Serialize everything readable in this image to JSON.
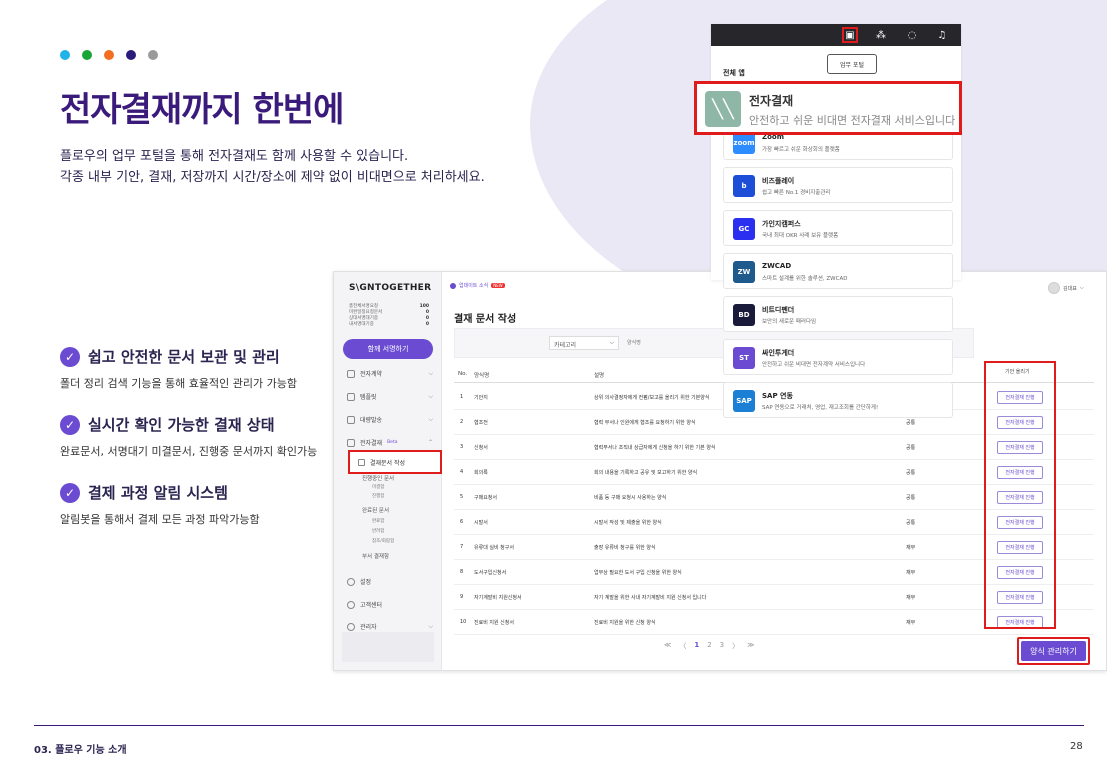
{
  "slide": {
    "title": "전자결재까지 한번에",
    "desc_1": "플로우의 업무 포털을 통해 전자결재도 함께 사용할 수 있습니다.",
    "desc_2": "각종 내부 기안, 결재, 저장까지 시간/장소에 제약 없이 비대면으로 처리하세요.",
    "dot_colors": [
      "#1fb3e8",
      "#1aa637",
      "#f26f21",
      "#2a1d7a",
      "#9a9a9a"
    ],
    "features": [
      {
        "title": "쉽고 안전한 문서 보관 및 관리",
        "desc": "폴더 정리 검색 기능을 통해 효율적인 관리가 가능함"
      },
      {
        "title": "실시간 확인 가능한 결재 상태",
        "desc": "완료문서, 서명대기 미결문서, 진행중 문서까지 확인가능"
      },
      {
        "title": "결제 과정 알림 시스템",
        "desc": "알림봇을 통해서 결제 모든 과정 파악가능함"
      }
    ],
    "footer_left": "03. 플로우 기능 소개",
    "footer_right": "28",
    "accent": "#6a4bd1",
    "highlight": "#e01b1b"
  },
  "app": {
    "logo": "S\\GNTOGETHER",
    "stats": [
      {
        "label": "총전체서명요청",
        "value": "100"
      },
      {
        "label": "미완일정요청문서",
        "value": "0"
      },
      {
        "label": "상대서명대기중",
        "value": "0"
      },
      {
        "label": "내서명대기중",
        "value": "0"
      }
    ],
    "sign_button": "함께 서명하기",
    "menu": {
      "m1": "전자계약",
      "m2": "템플릿",
      "m3": "대량발송",
      "m4": "전자결재",
      "m4_badge": "Beta",
      "highlighted": "결재문서 작성",
      "sub1": "진행중인 문서",
      "sub1a": "미결함",
      "sub1b": "진행함",
      "sub2": "완료된 문서",
      "sub2a": "완료함",
      "sub2b": "반려함",
      "sub2c": "참조/회람함",
      "sub3": "부서 결재함",
      "m5": "설정",
      "m6": "고객센터",
      "m7": "관리자"
    },
    "topbar_notice": "업데이트 소식",
    "topbar_new": "NEW",
    "user_name": "김대표",
    "page_title": "결재 문서 작성",
    "filter_category": "카테고리",
    "filter_placeholder": "양식명",
    "table_headers": {
      "no": "No.",
      "name": "양식명",
      "desc": "설명",
      "group": "",
      "action": "기안 올리기"
    },
    "rows": [
      {
        "no": "1",
        "name": "기안지",
        "desc": "상위 의사결정자에게 컨펌/보고를 올리기 위한 기본양식",
        "group": "공통",
        "action": "전자결재 진행"
      },
      {
        "no": "2",
        "name": "협조전",
        "desc": "협력 부서나 인원에게 협조를 요청하기 위한 양식",
        "group": "공통",
        "action": "전자결재 진행"
      },
      {
        "no": "3",
        "name": "신청서",
        "desc": "협력부서나 조직내 상급자에게 신청을 하기 위한 기본 양식",
        "group": "공통",
        "action": "전자결재 진행"
      },
      {
        "no": "4",
        "name": "회의록",
        "desc": "회의 내용을 기록하고 공유 및 보고하기 위한 양식",
        "group": "공통",
        "action": "전자결재 진행"
      },
      {
        "no": "5",
        "name": "구매요청서",
        "desc": "비품 등 구매 요청시 사용하는 양식",
        "group": "공통",
        "action": "전자결재 진행"
      },
      {
        "no": "6",
        "name": "시말서",
        "desc": "시말서 작성 및 제출을 위한 양식",
        "group": "공통",
        "action": "전자결재 진행"
      },
      {
        "no": "7",
        "name": "유류대 실비 청구서",
        "desc": "출장 유류비 청구를 위한 양식",
        "group": "재무",
        "action": "전자결재 진행"
      },
      {
        "no": "8",
        "name": "도서구입신청서",
        "desc": "업무상 필요한 도서 구입 신청을 위한 양식",
        "group": "재무",
        "action": "전자결재 진행"
      },
      {
        "no": "9",
        "name": "자기계발비 지원신청서",
        "desc": "자기 계발을 위한 사내 자기계발비 지원 신청서 입니다",
        "group": "재무",
        "action": "전자결재 진행"
      },
      {
        "no": "10",
        "name": "진료비 지원 신청서",
        "desc": "진료비 지원을 위한 신청 양식",
        "group": "재무",
        "action": "전자결재 진행"
      }
    ],
    "pager": {
      "first": "≪",
      "prev": "〈",
      "p1": "1",
      "p2": "2",
      "p3": "3",
      "next": "〉",
      "last": "≫"
    },
    "manage_button": "양식 관리하기"
  },
  "portal": {
    "tooltip": "업무 포털",
    "section": "전체 앱",
    "icons": [
      "portal-icon",
      "org-icon",
      "chat-icon",
      "bell-icon"
    ],
    "featured": {
      "name": "전자결재",
      "desc": "안전하고 쉬운 비대면 전자결재 서비스입니다"
    },
    "apps": [
      {
        "name": "Zoom",
        "desc": "가장 빠르고 쉬운 화상회의 플랫폼",
        "icon": "zoom",
        "color": "#2d8cff"
      },
      {
        "name": "비즈플레이",
        "desc": "쉽고 빠른 No.1 경비지출관리",
        "icon": "b",
        "color": "#1d4ed8"
      },
      {
        "name": "가인지캠퍼스",
        "desc": "국내 최대 OKR 사례 보유 플랫폼",
        "icon": "GC",
        "color": "#2b2ff0"
      },
      {
        "name": "ZWCAD",
        "desc": "스마트 설계를 위한 솔루션, ZWCAD",
        "icon": "ZW",
        "color": "#1e5a8c"
      },
      {
        "name": "비트디펜더",
        "desc": "보안의 새로운 패러다임",
        "icon": "BD",
        "color": "#1a1a3a"
      },
      {
        "name": "싸인투게더",
        "desc": "안전하고 쉬운 비대면 전자계약 서비스입니다",
        "icon": "ST",
        "color": "#6a4bd1"
      },
      {
        "name": "SAP 연동",
        "desc": "SAP 연동으로 거래처, 영업, 재고조회를 간단하게!",
        "icon": "SAP",
        "color": "#1c7fd6"
      }
    ]
  }
}
